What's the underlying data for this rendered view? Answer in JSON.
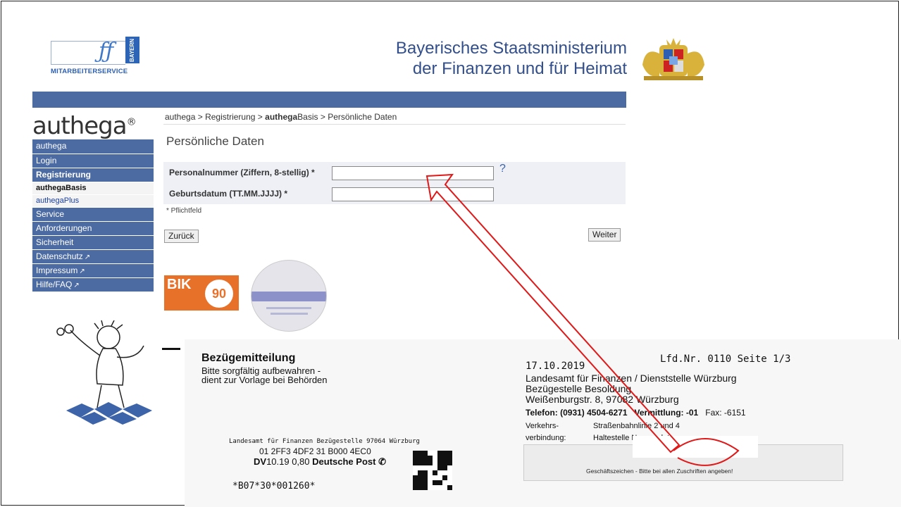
{
  "header": {
    "logo_text": "MITARBEITERSERVICE",
    "logo_region": "BAYERN",
    "ministry_line1": "Bayerisches Staatsministerium",
    "ministry_line2": "der Finanzen und für Heimat"
  },
  "sidebar": {
    "brand": "authega",
    "brand_reg": "®",
    "section_head": "authega",
    "items": [
      {
        "label": "Login"
      },
      {
        "label": "Registrierung"
      },
      {
        "label": "authegaBasis"
      },
      {
        "label": "authegaPlus"
      },
      {
        "label": "Service"
      },
      {
        "label": "Anforderungen"
      },
      {
        "label": "Sicherheit"
      },
      {
        "label": "Datenschutz"
      },
      {
        "label": "Impressum"
      },
      {
        "label": "Hilfe/FAQ"
      }
    ]
  },
  "breadcrumb": {
    "part1": "authega",
    "sep": " > ",
    "part2": "Registrierung",
    "part3_bold": "authega",
    "part3_rest": "Basis",
    "part4": "Persönliche Daten"
  },
  "main": {
    "title": "Persönliche Daten",
    "fields": [
      {
        "label": "Personalnummer (Ziffern, 8-stellig) *",
        "value": ""
      },
      {
        "label": "Geburtsdatum (TT.MM.JJJJ) *",
        "value": ""
      }
    ],
    "help": "?",
    "required_note": "* Pflichtfeld",
    "back_label": "Zurück",
    "next_label": "Weiter",
    "bik_text": "BIK",
    "bik_score": "90"
  },
  "letter": {
    "title": "Bezügemitteilung",
    "subtitle_line1": "Bitte sorgfältig aufbewahren -",
    "subtitle_line2": "dient zur Vorlage bei Behörden",
    "lfd": "Lfd.Nr. 0110 Seite 1/3",
    "date": "17.10.2019",
    "addr_line1": "Landesamt für Finanzen / Dienststelle Würzburg",
    "addr_line2": "Bezügestelle Besoldung",
    "addr_line3": "Weißenburgstr. 8, 97082 Würzburg",
    "tel": "Telefon: (0931) 4504-6271",
    "vermittlung": "Vermittlung: -01",
    "fax": "Fax: -6151",
    "verkehr_label1": "Verkehrs-",
    "verkehr_label2": "verbindung:",
    "verkehr_val1": "Straßenbahnlinie 2 und 4",
    "verkehr_val2": "Haltestelle Neunerplatz",
    "sender": "Landesamt für Finanzen Bezügestelle 97064 Würzburg",
    "code": "01 2FF3 4DF2 31 B000 4EC0",
    "dv": "DV",
    "dv_rest": "10.19  0,80",
    "post": "Deutsche Post",
    "barcode": "*B07*30*001260*",
    "gz": "Geschäftszeichen - Bitte bei allen Zuschriften angeben!"
  }
}
